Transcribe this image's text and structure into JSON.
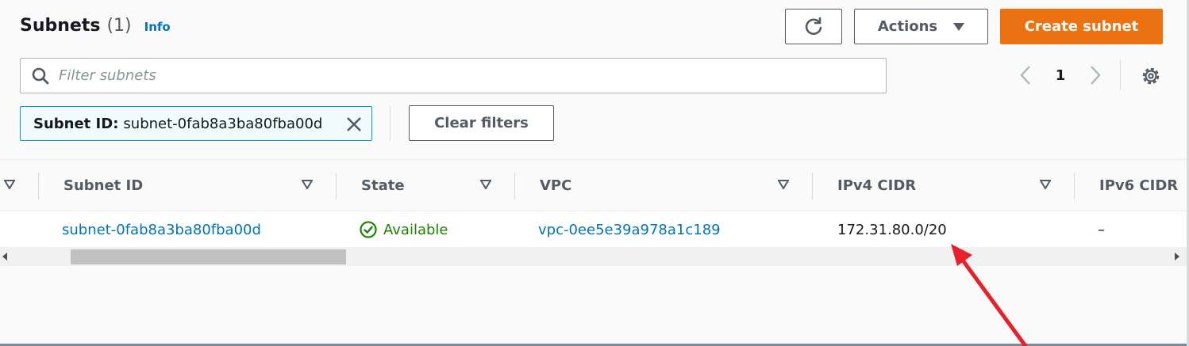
{
  "header": {
    "title": "Subnets",
    "count": "(1)",
    "info_label": "Info"
  },
  "toolbar": {
    "refresh_icon": "refresh-icon",
    "actions_label": "Actions",
    "create_label": "Create subnet"
  },
  "search": {
    "placeholder": "Filter subnets",
    "value": ""
  },
  "pagination": {
    "current_page": "1"
  },
  "filter_token": {
    "key": "Subnet ID:",
    "value": "subnet-0fab8a3ba80fba00d"
  },
  "clear_filters_label": "Clear filters",
  "table": {
    "columns": [
      "Subnet ID",
      "State",
      "VPC",
      "IPv4 CIDR",
      "IPv6 CIDR"
    ],
    "rows": [
      {
        "subnet_id": "subnet-0fab8a3ba80fba00d",
        "state": "Available",
        "vpc": "vpc-0ee5e39a978a1c189",
        "ipv4_cidr": "172.31.80.0/20",
        "ipv6_cidr": "–"
      }
    ]
  },
  "colors": {
    "primary_button": "#ec7211",
    "link": "#0073bb",
    "status_ok": "#1d8102",
    "annotation_arrow": "#e8202a"
  }
}
